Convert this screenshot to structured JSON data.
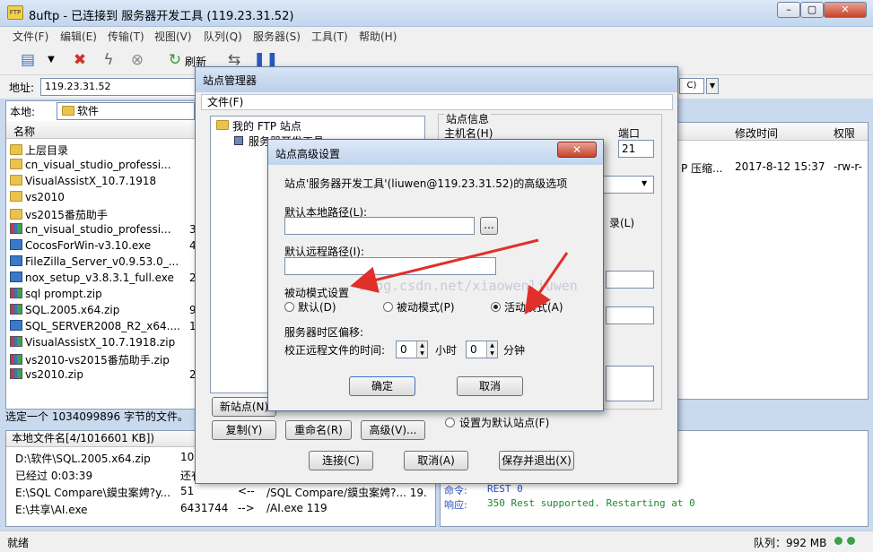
{
  "window": {
    "title": "8uftp - 已连接到 服务器开发工具 (119.23.31.52)",
    "app_icon_text": "FTP",
    "min": "–",
    "restore": "▢",
    "close": "✕"
  },
  "menu": [
    "文件(F)",
    "编辑(E)",
    "传输(T)",
    "视图(V)",
    "队列(Q)",
    "服务器(S)",
    "工具(T)",
    "帮助(H)"
  ],
  "toolbar": {
    "refresh_label": "刷新"
  },
  "address": {
    "label": "地址:",
    "value": "119.23.31.52"
  },
  "local": {
    "tab_label": "本地:",
    "path": "软件",
    "header_name": "名称",
    "files": [
      {
        "name": "上层目录",
        "type": "up",
        "size": ""
      },
      {
        "name": "cn_visual_studio_professi...",
        "type": "folder",
        "size": ""
      },
      {
        "name": "VisualAssistX_10.7.1918",
        "type": "folder",
        "size": ""
      },
      {
        "name": "vs2010",
        "type": "folder",
        "size": ""
      },
      {
        "name": "vs2015番茄助手",
        "type": "folder",
        "size": ""
      },
      {
        "name": "cn_visual_studio_professi...",
        "type": "zip",
        "size": "39"
      },
      {
        "name": "CocosForWin-v3.10.exe",
        "type": "exe",
        "size": "4"
      },
      {
        "name": "FileZilla_Server_v0.9.53.0_...",
        "type": "exe",
        "size": ""
      },
      {
        "name": "nox_setup_v3.8.3.1_full.exe",
        "type": "exe",
        "size": "2"
      },
      {
        "name": "sql prompt.zip",
        "type": "zip",
        "size": ""
      },
      {
        "name": "SQL.2005.x64.zip",
        "type": "zip",
        "size": "9"
      },
      {
        "name": "SQL_SERVER2008_R2_x64....",
        "type": "exe",
        "size": "10"
      },
      {
        "name": "VisualAssistX_10.7.1918.zip",
        "type": "zip",
        "size": ""
      },
      {
        "name": "vs2010-vs2015番茄助手.zip",
        "type": "zip",
        "size": ""
      },
      {
        "name": "vs2010.zip",
        "type": "zip",
        "size": "25"
      }
    ],
    "status": "选定一个 1034099896 字节的文件。"
  },
  "remote": {
    "header_time": "修改时间",
    "header_perm": "权限",
    "row_type": "P 压缩...",
    "row_time": "2017-8-12 15:37",
    "row_perm": "-rw-r-"
  },
  "queue": {
    "header": "本地文件名[4/1016601 KB])",
    "rows": [
      {
        "a": "D:\\软件\\SQL.2005.x64.zip",
        "b": "103",
        "c": "",
        "d": ""
      },
      {
        "a": "已经过 0:03:39",
        "b": "还有",
        "c": "",
        "d": ""
      },
      {
        "a": "E:\\SQL Compare\\鏌虫案娉?y...",
        "b": "51",
        "c": "<--",
        "d": "/SQL Compare/鏌虫案娉?... 19."
      },
      {
        "a": "E:\\共享\\AI.exe",
        "b": "6431744",
        "c": "-->",
        "d": "/AI.exe   119"
      }
    ]
  },
  "log": {
    "lines": [
      {
        "k": "命令:",
        "v": "REST 0"
      },
      {
        "k": "响应:",
        "v": "350 Rest supported. Restarting at 0"
      }
    ]
  },
  "statusbar": {
    "left": "就绪",
    "queue": "队列：992 MB"
  },
  "site_manager": {
    "title": "站点管理器",
    "menu": "文件(F)",
    "tree_root": "我的 FTP 站点",
    "tree_child": "服务器开发工具",
    "info_group": "站点信息",
    "host_label": "主机名(H)",
    "port_label": "端口",
    "port_value": "21",
    "partial_label": "录(L)",
    "new_site": "新站点(N)",
    "copy": "复制(Y)",
    "rename": "重命名(R)",
    "advanced": "高级(V)...",
    "default_site": "设置为默认站点(F)",
    "connect": "连接(C)",
    "cancel": "取消(A)",
    "save_exit": "保存并退出(X)"
  },
  "advanced": {
    "title": "站点高级设置",
    "close": "✕",
    "description": "站点'服务器开发工具'(liuwen@119.23.31.52)的高级选项",
    "local_path_label": "默认本地路径(L):",
    "local_path_value": "",
    "browse": "...",
    "remote_path_label": "默认远程路径(I):",
    "remote_path_value": "",
    "passive_label": "被动模式设置",
    "mode_default": "默认(D)",
    "mode_passive": "被动模式(P)",
    "mode_active": "活动模式(A)",
    "tz_label": "服务器时区偏移:",
    "tz_adjust": "校正远程文件的时间:",
    "hours_value": "0",
    "hours_unit": "小时",
    "minutes_value": "0",
    "minutes_unit": "分钟",
    "ok": "确定",
    "cancel": "取消"
  },
  "watermark": "blog.csdn.net/xiaowenliuwen"
}
